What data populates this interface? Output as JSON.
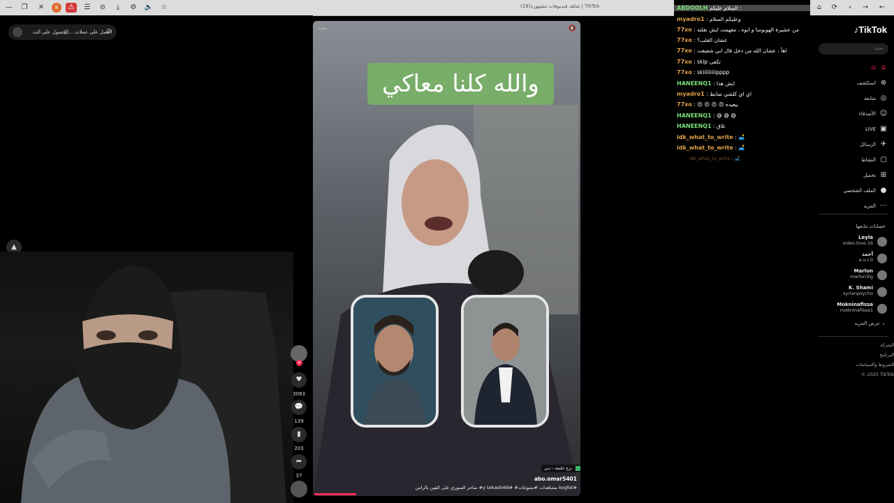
{
  "browser": {
    "tab_title": "(19)شاهد فيديوهات مشهورة | TikTok",
    "adblock_badge": "8"
  },
  "promo": {
    "text_a": "احصل على عملات",
    "text_b": "الحصول على الت..."
  },
  "video": {
    "caption": "والله كلنا معاكي",
    "author": "abo.omar5401",
    "location": "برج خليفة - دبي",
    "description": "ساخر السوري على الفين بالراس #y tekashi69# #مشاهدات #متنوعات kogfet#"
  },
  "actions": [
    {
      "icon": "heart-icon",
      "count": "3083"
    },
    {
      "icon": "comment-icon",
      "count": "139"
    },
    {
      "icon": "bookmark-icon",
      "count": "203"
    },
    {
      "icon": "share-icon",
      "count": "37"
    }
  ],
  "chat": [
    {
      "user": "ABDOOLH",
      "color": "#7be07b",
      "msg": "السلام عليكم : ",
      "highlight": true
    },
    {
      "user": "myadro1",
      "color": "#e0a24a",
      "msg": ": وعليكم السلام"
    },
    {
      "user": "77xo",
      "color": "#e0a24a",
      "msg": ": من عشيرة الهوبوسا و ابوه ، مفهمت ايش نقلته"
    },
    {
      "user": "77xo",
      "color": "#e0a24a",
      "msg": ": عشان القلب؟"
    },
    {
      "user": "77xo",
      "color": "#e0a24a",
      "msg": ": اهآ ، عشان الله من دخل قال ابي شفيقت"
    },
    {
      "user": "77xo",
      "color": "#e0a24a",
      "msg": ": skip تكفى"
    },
    {
      "user": "77xo",
      "color": "#e0a24a",
      "msg": ": skiiiiiiiiipppp"
    },
    {
      "user": "HANEENQ1",
      "color": "#7be07b",
      "msg": ": ايش هذا"
    },
    {
      "user": "myadro1",
      "color": "#e0a24a",
      "msg": ": اي اي كلشي ضابط"
    },
    {
      "user": "77xo",
      "color": "#e0a24a",
      "msg": ": 😣 😣 😣 😣 بيعيده"
    },
    {
      "user": "HANEENQ1",
      "color": "#7be07b",
      "msg": ": 😅 😅 😅"
    },
    {
      "user": "HANEENQ1",
      "color": "#7be07b",
      "msg": ": تلاق"
    },
    {
      "user": "idk_what_to_write",
      "color": "#e0a24a",
      "msg": ": 🛋️"
    },
    {
      "user": "idk_what_to_write",
      "color": "#e0a24a",
      "msg": ": 🛋️"
    },
    {
      "user": "idk_what_to_write",
      "color": "#c28a3c",
      "msg": ": 🛋️",
      "faded": true
    }
  ],
  "sidebar": {
    "logo": "TikTok",
    "search_placeholder": "بحث",
    "nav": [
      {
        "label": "لك",
        "icon": "home-icon",
        "active": true
      },
      {
        "label": "استكشف",
        "icon": "compass-icon"
      },
      {
        "label": "متابعة",
        "icon": "following-icon"
      },
      {
        "label": "الأصدقاء",
        "icon": "friends-icon"
      },
      {
        "label": "LIVE",
        "icon": "live-icon"
      },
      {
        "label": "الرسائل",
        "icon": "messages-icon"
      },
      {
        "label": "النشاط",
        "icon": "activity-icon"
      },
      {
        "label": "تحميل",
        "icon": "upload-icon"
      },
      {
        "label": "الملف الشخصي",
        "icon": "profile-icon"
      },
      {
        "label": "المزيد",
        "icon": "more-icon"
      }
    ],
    "following_title": "حسابات تتابعها",
    "following": [
      {
        "name": "Leyla",
        "handle": "video.love.16"
      },
      {
        "name": "أحمد",
        "handle": "a.u.r.0"
      },
      {
        "name": "Marlon",
        "handle": "marlon3lg"
      },
      {
        "name": "K. Shami",
        "handle": "syrianpsycho"
      },
      {
        "name": "Mokninafissa",
        "handle": "mokninafissa1"
      }
    ],
    "see_more": "عرض المزيد",
    "footer": [
      "الشركة",
      "البرنامج",
      "الشروط والسياسات",
      "© 2025 TikTok"
    ]
  }
}
